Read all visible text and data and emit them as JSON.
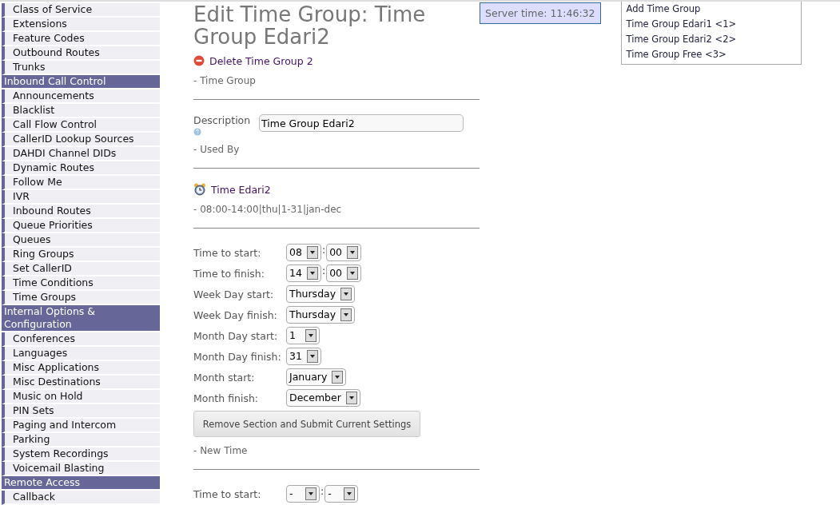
{
  "sidebar": {
    "items": [
      {
        "kind": "item",
        "label": "Class of Service"
      },
      {
        "kind": "item",
        "label": "Extensions"
      },
      {
        "kind": "item",
        "label": "Feature Codes"
      },
      {
        "kind": "item",
        "label": "Outbound Routes"
      },
      {
        "kind": "item",
        "label": "Trunks"
      },
      {
        "kind": "header",
        "label": "Inbound Call Control"
      },
      {
        "kind": "item",
        "label": "Announcements"
      },
      {
        "kind": "item",
        "label": "Blacklist"
      },
      {
        "kind": "item",
        "label": "Call Flow Control"
      },
      {
        "kind": "item",
        "label": "CallerID Lookup Sources"
      },
      {
        "kind": "item",
        "label": "DAHDI Channel DIDs"
      },
      {
        "kind": "item",
        "label": "Dynamic Routes"
      },
      {
        "kind": "item",
        "label": "Follow Me"
      },
      {
        "kind": "item",
        "label": "IVR"
      },
      {
        "kind": "item",
        "label": "Inbound Routes"
      },
      {
        "kind": "item",
        "label": "Queue Priorities"
      },
      {
        "kind": "item",
        "label": "Queues"
      },
      {
        "kind": "item",
        "label": "Ring Groups"
      },
      {
        "kind": "item",
        "label": "Set CallerID"
      },
      {
        "kind": "item",
        "label": "Time Conditions"
      },
      {
        "kind": "item",
        "label": "Time Groups"
      },
      {
        "kind": "header",
        "label": "Internal Options & Configuration"
      },
      {
        "kind": "item",
        "label": "Conferences"
      },
      {
        "kind": "item",
        "label": "Languages"
      },
      {
        "kind": "item",
        "label": "Misc Applications"
      },
      {
        "kind": "item",
        "label": "Misc Destinations"
      },
      {
        "kind": "item",
        "label": "Music on Hold"
      },
      {
        "kind": "item",
        "label": "PIN Sets"
      },
      {
        "kind": "item",
        "label": "Paging and Intercom"
      },
      {
        "kind": "item",
        "label": "Parking"
      },
      {
        "kind": "item",
        "label": "System Recordings"
      },
      {
        "kind": "item",
        "label": "Voicemail Blasting"
      },
      {
        "kind": "header",
        "label": "Remote Access"
      },
      {
        "kind": "item",
        "label": "Callback"
      }
    ]
  },
  "title": "Edit Time Group: Time Group Edari2",
  "delete_link": "Delete Time Group 2",
  "time_group_heading": "- Time Group",
  "description": {
    "label": "Description",
    "value": "Time Group Edari2"
  },
  "used_by_heading": "- Used By",
  "used_by": {
    "link": "Time Edari2",
    "detail": "- 08:00-14:00|thu|1-31|jan-dec"
  },
  "time_fields": [
    {
      "kind": "time",
      "label": "Time to start:",
      "hour": "08",
      "separator": ":",
      "minute": "00"
    },
    {
      "kind": "time",
      "label": "Time to finish:",
      "hour": "14",
      "separator": ":",
      "minute": "00"
    },
    {
      "kind": "select",
      "label": "Week Day start:",
      "value": "Thursday"
    },
    {
      "kind": "select",
      "label": "Week Day finish:",
      "value": "Thursday"
    },
    {
      "kind": "select",
      "label": "Month Day start:",
      "value": "1"
    },
    {
      "kind": "select",
      "label": "Month Day finish:",
      "value": "31"
    },
    {
      "kind": "select",
      "label": "Month start:",
      "value": "January"
    },
    {
      "kind": "select",
      "label": "Month finish:",
      "value": "December"
    }
  ],
  "remove_button": "Remove Section and Submit Current Settings",
  "new_time_heading": "- New Time",
  "new_time_fields": [
    {
      "kind": "time",
      "label": "Time to start:",
      "hour": "-",
      "separator": ":",
      "minute": "-"
    }
  ],
  "server_time": "Server time: 11:46:32",
  "right_nav": [
    "Add Time Group",
    "Time Group Edari1 <1>",
    "Time Group Edari2 <2>",
    "Time Group Free <3>"
  ]
}
